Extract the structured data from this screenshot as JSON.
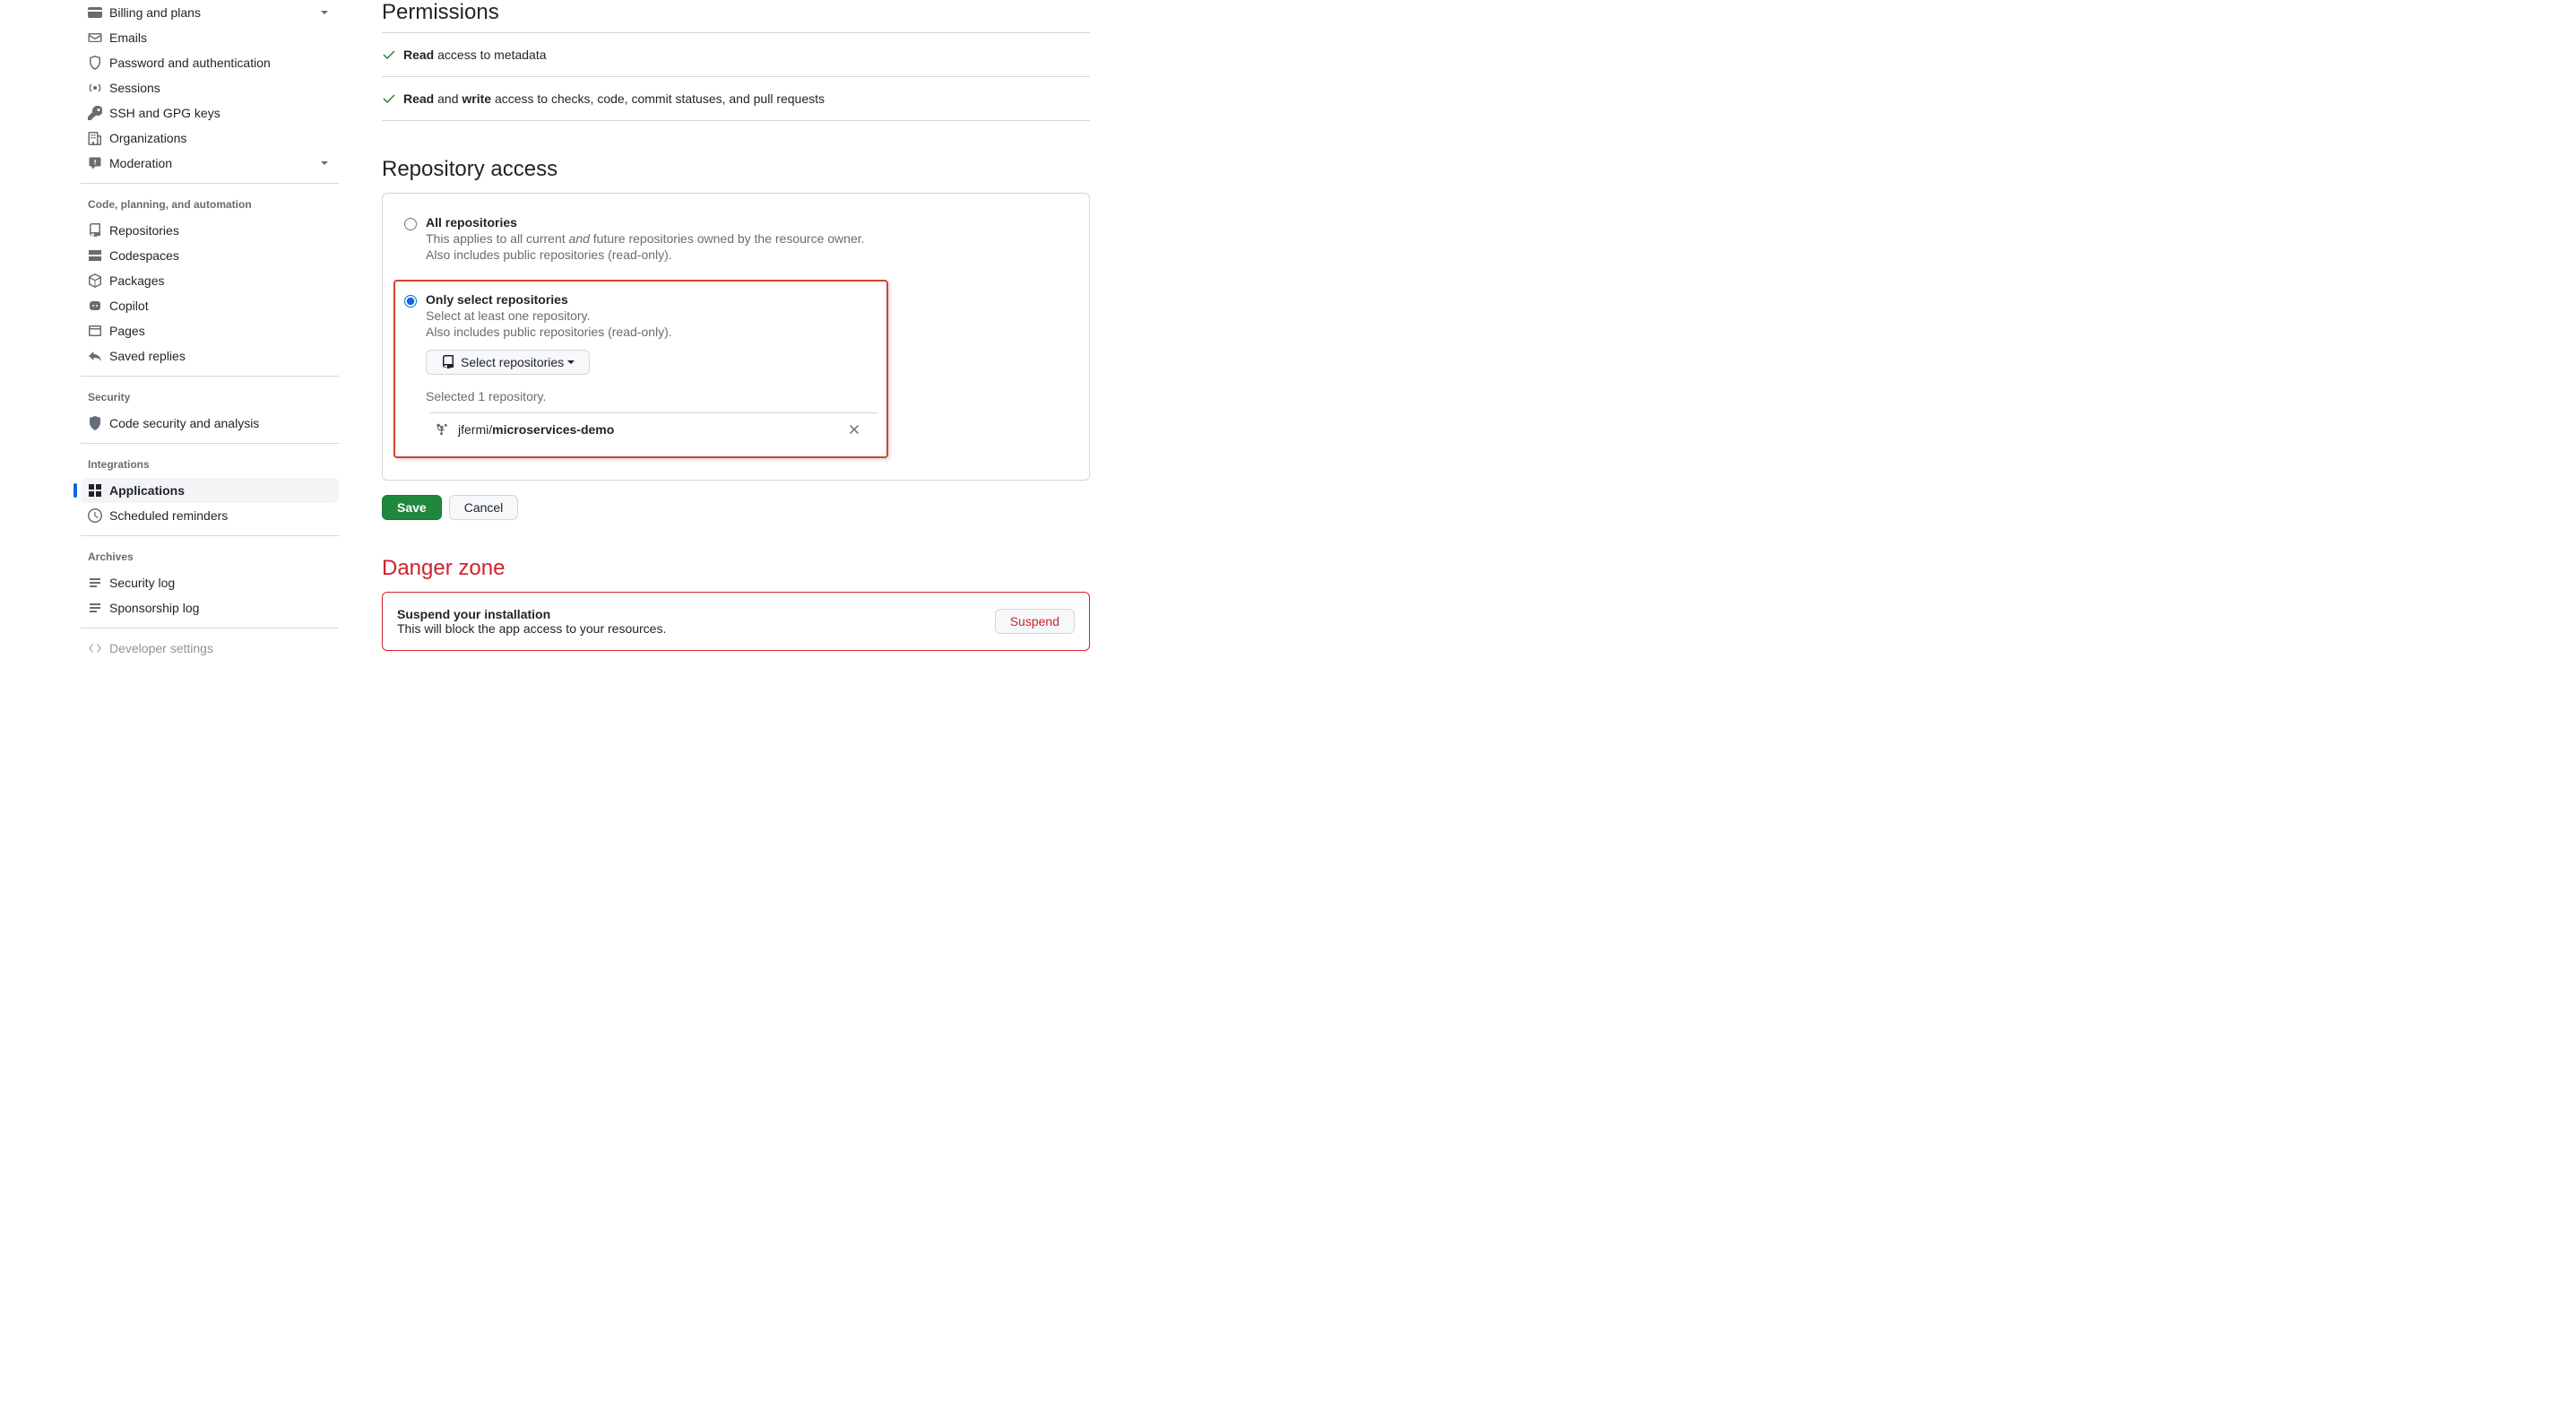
{
  "sidebar": {
    "access": [
      {
        "label": "Billing and plans",
        "icon": "credit-card",
        "chevron": true
      },
      {
        "label": "Emails",
        "icon": "mail"
      },
      {
        "label": "Password and authentication",
        "icon": "shield-lock"
      },
      {
        "label": "Sessions",
        "icon": "broadcast"
      },
      {
        "label": "SSH and GPG keys",
        "icon": "key"
      },
      {
        "label": "Organizations",
        "icon": "organization"
      },
      {
        "label": "Moderation",
        "icon": "report",
        "chevron": true
      }
    ],
    "section_code": "Code, planning, and automation",
    "code": [
      {
        "label": "Repositories",
        "icon": "repo"
      },
      {
        "label": "Codespaces",
        "icon": "codespaces"
      },
      {
        "label": "Packages",
        "icon": "package"
      },
      {
        "label": "Copilot",
        "icon": "copilot"
      },
      {
        "label": "Pages",
        "icon": "browser"
      },
      {
        "label": "Saved replies",
        "icon": "reply"
      }
    ],
    "section_security": "Security",
    "security": [
      {
        "label": "Code security and analysis",
        "icon": "shield"
      }
    ],
    "section_integrations": "Integrations",
    "integrations": [
      {
        "label": "Applications",
        "icon": "apps",
        "active": true
      },
      {
        "label": "Scheduled reminders",
        "icon": "clock"
      }
    ],
    "section_archives": "Archives",
    "archives": [
      {
        "label": "Security log",
        "icon": "log"
      },
      {
        "label": "Sponsorship log",
        "icon": "log"
      }
    ],
    "dev_settings": "Developer settings"
  },
  "permissions": {
    "heading": "Permissions",
    "items": [
      {
        "strong1": "Read",
        "rest": " access to metadata"
      },
      {
        "strong1": "Read",
        "mid": " and ",
        "strong2": "write",
        "rest": " access to checks, code, commit statuses, and pull requests"
      }
    ]
  },
  "repo_access": {
    "heading": "Repository access",
    "all_label": "All repositories",
    "all_desc_pre": "This applies to all current ",
    "all_desc_and": "and",
    "all_desc_post": " future repositories owned by the resource owner.",
    "all_desc2": "Also includes public repositories (read-only).",
    "only_label": "Only select repositories",
    "only_desc1": "Select at least one repository.",
    "only_desc2": "Also includes public repositories (read-only).",
    "select_btn": "Select repositories",
    "selected_count": "Selected 1 repository.",
    "selected_owner": "jfermi/",
    "selected_repo": "microservices-demo"
  },
  "actions": {
    "save": "Save",
    "cancel": "Cancel"
  },
  "danger": {
    "heading": "Danger zone",
    "suspend_title": "Suspend your installation",
    "suspend_desc": "This will block the app access to your resources.",
    "suspend_btn": "Suspend"
  }
}
